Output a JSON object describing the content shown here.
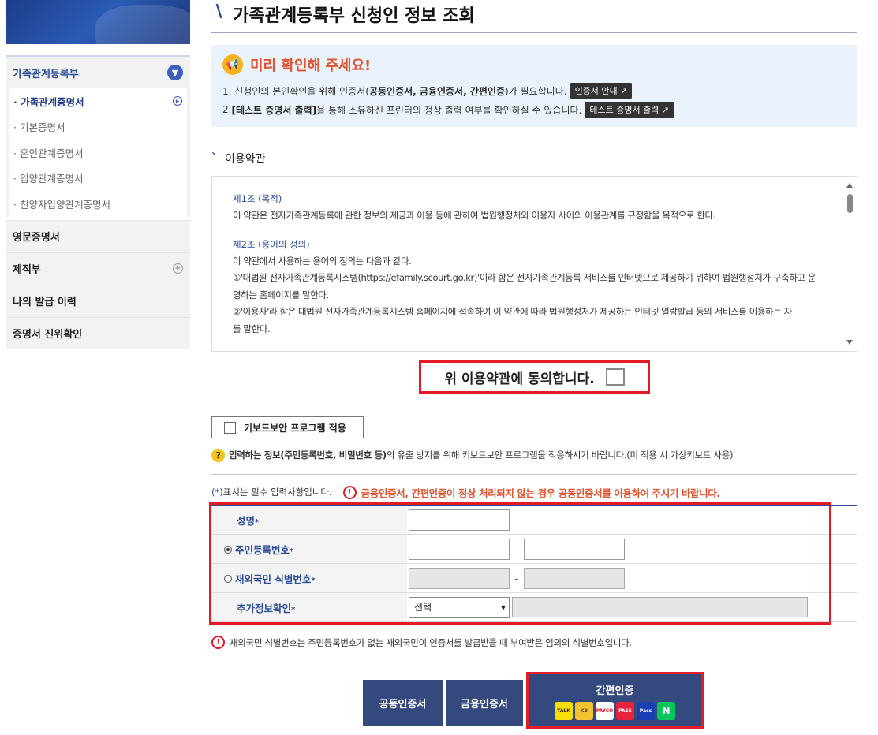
{
  "sidebar": {
    "group_title": "가족관계등록부",
    "sub_items": [
      {
        "label": "· 가족관계증명서",
        "active": true
      },
      {
        "label": "· 기본증명서",
        "active": false
      },
      {
        "label": "· 혼인관계증명서",
        "active": false
      },
      {
        "label": "· 입양관계증명서",
        "active": false
      },
      {
        "label": "· 친양자입양관계증명서",
        "active": false
      }
    ],
    "menus": [
      {
        "label": "영문증명서",
        "has_plus": false
      },
      {
        "label": "제적부",
        "has_plus": true
      },
      {
        "label": "나의 발급 이력",
        "has_plus": false
      },
      {
        "label": "증명서 진위확인",
        "has_plus": false
      }
    ]
  },
  "page": {
    "title": "가족관계등록부 신청인 정보 조회"
  },
  "notice": {
    "title": "미리 확인해 주세요!",
    "line1_prefix": "1. 신청인의 본인확인을 위해 인증서(",
    "line1_bold": "공동인증서, 금융인증서, 간편인증",
    "line1_suffix": ")가 필요합니다.",
    "line1_button": "인증서 안내 ↗",
    "line2_prefix": "2. ",
    "line2_bold": "[테스트 증명서 출력]",
    "line2_suffix": "을 통해 소유하신 프린터의 정상 출력 여부를 확인하실 수 있습니다.",
    "line2_button": "테스트 증명서 출력 ↗"
  },
  "terms": {
    "heading": "이용약관",
    "art1_title": "제1조 (목적)",
    "art1_text": "이 약관은 전자가족관계등록에 관한 정보의 제공과 이용 등에 관하여 법원행정처와 이용자 사이의 이용관계를 규정함을 목적으로 한다.",
    "art2_title": "제2조 (용어의 정의)",
    "art2_intro": "이 약관에서 사용하는 용어의 정의는 다음과 같다.",
    "art2_item1_line1": "①'대법원 전자가족관계등록시스템(https://efamily.scourt.go.kr)'이라 함은 전자가족관계등록 서비스를 인터넷으로 제공하기 위하여 법원행정처가 구축하고 운",
    "art2_item1_line2": "영하는 홈페이지를 말한다.",
    "art2_item2_line1": "②'이용자'라 함은 대법원 전자가족관계등록시스템 홈페이지에 접속하여 이 약관에 따라 법원행정처가 제공하는 인터넷 열람발급 등의 서비스를 이용하는 자",
    "art2_item2_line2": "를 말한다."
  },
  "agree_label": "위 이용약관에 동의합니다.",
  "keyboard": {
    "button_label": "키보드보안 프로그램 적용",
    "info_bold": "입력하는 정보(주민등록번호, 비밀번호 등)",
    "info_text": "의 유출 방지를 위해 키보드보안 프로그램을 적용하시기 바랍니다.(미 적용 시 가상키보드 사용)"
  },
  "required": {
    "note_star": "(*)",
    "note_text": "표시는 필수 입력사항입니다.",
    "warning": "금융인증서, 간편인증이 정상 처리되지 않는 경우 공동인증서를 이용하여 주시기 바랍니다."
  },
  "form": {
    "name_label": "성명",
    "rrn_label": "주민등록번호",
    "foreign_label": "재외국민 식별번호",
    "extra_label": "추가정보확인",
    "star": "*",
    "dash": "-",
    "select_value": "선택"
  },
  "footnote": "재외국민 식별번호는 주민등록번호가 없는 재외국민이 인증서를 발급받을 때 부여받은 임의의 식별번호입니다.",
  "buttons": {
    "joint_cert": "공동인증서",
    "financial_cert": "금융인증서",
    "easy_cert": "간편인증",
    "easy_icons": [
      {
        "name": "kakao-icon",
        "text": "TALK",
        "bg": "#f9e000",
        "fg": "#3a1d1d"
      },
      {
        "name": "kb-icon",
        "text": "KB",
        "bg": "#f4c430",
        "fg": "#5a4a2a"
      },
      {
        "name": "payco-icon",
        "text": "PAYCO",
        "bg": "#ffffff",
        "fg": "#e4152a"
      },
      {
        "name": "pass-icon",
        "text": "PASS",
        "bg": "#e7223d",
        "fg": "#ffffff"
      },
      {
        "name": "samsung-pass-icon",
        "text": "Pass",
        "bg": "#1a3fb5",
        "fg": "#ffffff"
      },
      {
        "name": "naver-icon",
        "text": "N",
        "bg": "#03c75a",
        "fg": "#ffffff"
      }
    ]
  }
}
